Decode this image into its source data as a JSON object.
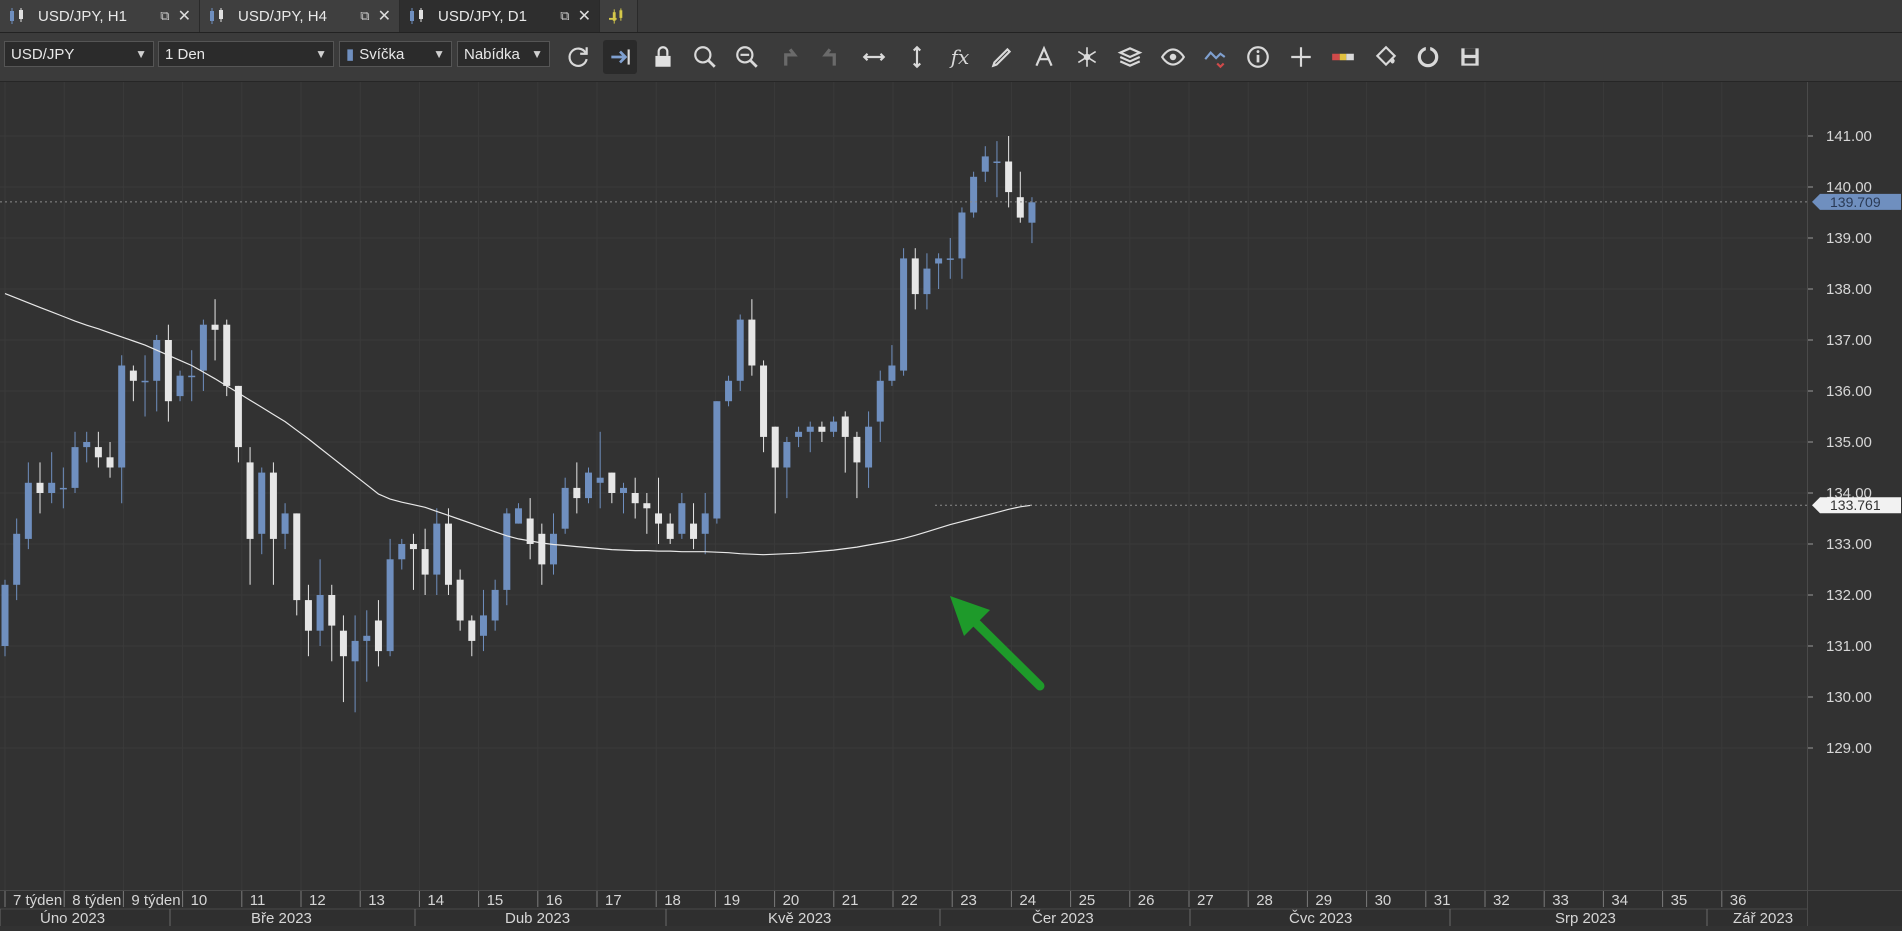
{
  "tabs": [
    {
      "label": "USD/JPY, H1"
    },
    {
      "label": "USD/JPY, H4"
    },
    {
      "label": "USD/JPY, D1"
    }
  ],
  "toolbar": {
    "instrument": "USD/JPY",
    "period": "1 Den",
    "chart_style": "Svíčka",
    "price_side": "Nabídka",
    "icons": [
      "refresh-icon",
      "shift-chart-icon",
      "lock-icon",
      "zoom-in-icon",
      "zoom-out-icon",
      "undo-icon",
      "redo-icon",
      "fit-horizontal-icon",
      "fit-vertical-icon",
      "indicators-fx-icon",
      "pencil-icon",
      "text-tool-icon",
      "pattern-icon",
      "layers-icon",
      "eye-icon",
      "signals-icon",
      "info-icon",
      "crosshair-icon",
      "color-bar-icon",
      "fill-bucket-icon",
      "reset-icon",
      "save-icon"
    ]
  },
  "colors": {
    "bull": "#6f8fbf",
    "bear": "#e6e6e6",
    "ma": "#e8e8e8",
    "arrow": "#1e9a2a",
    "price_tag": "#6f8fbf"
  },
  "chart_data": {
    "type": "candlestick",
    "yticks": [
      "141.00",
      "140.00",
      "139.00",
      "138.00",
      "137.00",
      "136.00",
      "135.00",
      "134.00",
      "133.00",
      "132.00",
      "131.00",
      "130.00",
      "129.00"
    ],
    "ylim": [
      128.6,
      141.9
    ],
    "current_price": "139.709",
    "ma_value": "133.761",
    "candles": [
      [
        131.0,
        132.2,
        130.8,
        132.3
      ],
      [
        132.2,
        133.2,
        131.9,
        133.5
      ],
      [
        133.1,
        134.2,
        132.9,
        134.6
      ],
      [
        134.2,
        134.0,
        133.6,
        134.6
      ],
      [
        134.0,
        134.2,
        133.8,
        134.8
      ],
      [
        134.1,
        134.1,
        133.7,
        134.5
      ],
      [
        134.1,
        134.9,
        134.0,
        135.2
      ],
      [
        134.9,
        135.0,
        134.6,
        135.2
      ],
      [
        134.9,
        134.7,
        134.5,
        135.2
      ],
      [
        134.7,
        134.5,
        134.3,
        135.0
      ],
      [
        134.5,
        136.5,
        133.8,
        136.7
      ],
      [
        136.4,
        136.2,
        135.8,
        136.5
      ],
      [
        136.2,
        136.2,
        135.5,
        136.7
      ],
      [
        136.2,
        137.0,
        135.6,
        137.1
      ],
      [
        137.0,
        135.8,
        135.4,
        137.3
      ],
      [
        135.9,
        136.3,
        135.8,
        136.4
      ],
      [
        136.3,
        136.3,
        135.8,
        136.8
      ],
      [
        136.4,
        137.3,
        136.0,
        137.4
      ],
      [
        137.3,
        137.2,
        136.6,
        137.8
      ],
      [
        137.3,
        136.1,
        135.9,
        137.4
      ],
      [
        136.1,
        134.9,
        134.6,
        136.1
      ],
      [
        134.6,
        133.1,
        132.2,
        134.9
      ],
      [
        133.2,
        134.4,
        132.8,
        134.5
      ],
      [
        134.4,
        133.1,
        132.2,
        134.6
      ],
      [
        133.2,
        133.6,
        132.9,
        133.8
      ],
      [
        133.6,
        131.9,
        131.6,
        133.6
      ],
      [
        131.9,
        131.3,
        130.8,
        132.2
      ],
      [
        131.3,
        132.0,
        131.0,
        132.7
      ],
      [
        132.0,
        131.4,
        130.7,
        132.2
      ],
      [
        131.3,
        130.8,
        129.9,
        131.6
      ],
      [
        130.7,
        131.1,
        129.7,
        131.6
      ],
      [
        131.1,
        131.2,
        130.3,
        131.7
      ],
      [
        131.5,
        130.9,
        130.6,
        131.9
      ],
      [
        130.9,
        132.7,
        130.8,
        133.1
      ],
      [
        132.7,
        133.0,
        132.5,
        133.1
      ],
      [
        133.0,
        132.9,
        132.1,
        133.2
      ],
      [
        132.9,
        132.4,
        132.0,
        133.3
      ],
      [
        132.4,
        133.4,
        132.0,
        133.7
      ],
      [
        133.4,
        132.2,
        132.0,
        133.7
      ],
      [
        132.3,
        131.5,
        131.3,
        132.5
      ],
      [
        131.5,
        131.1,
        130.8,
        131.6
      ],
      [
        131.2,
        131.6,
        130.9,
        132.1
      ],
      [
        131.5,
        132.1,
        131.3,
        132.3
      ],
      [
        132.1,
        133.6,
        131.8,
        133.7
      ],
      [
        133.4,
        133.7,
        133.4,
        133.8
      ],
      [
        133.5,
        133.0,
        132.7,
        133.9
      ],
      [
        133.2,
        132.6,
        132.2,
        133.4
      ],
      [
        132.6,
        133.2,
        132.4,
        133.6
      ],
      [
        133.3,
        134.1,
        133.2,
        134.3
      ],
      [
        134.1,
        133.9,
        133.6,
        134.6
      ],
      [
        133.9,
        134.4,
        133.8,
        134.5
      ],
      [
        134.2,
        134.3,
        133.7,
        135.2
      ],
      [
        134.4,
        134.0,
        133.8,
        134.4
      ],
      [
        134.0,
        134.1,
        133.6,
        134.2
      ],
      [
        134.0,
        133.8,
        133.5,
        134.3
      ],
      [
        133.8,
        133.7,
        133.2,
        134.0
      ],
      [
        133.6,
        133.4,
        133.0,
        134.3
      ],
      [
        133.4,
        133.1,
        133.0,
        133.6
      ],
      [
        133.2,
        133.8,
        133.1,
        134.0
      ],
      [
        133.4,
        133.1,
        132.9,
        133.8
      ],
      [
        133.2,
        133.6,
        132.8,
        134.0
      ],
      [
        133.5,
        135.8,
        133.4,
        135.8
      ],
      [
        135.8,
        136.2,
        135.7,
        136.3
      ],
      [
        136.2,
        137.4,
        136.0,
        137.5
      ],
      [
        137.4,
        136.5,
        136.3,
        137.8
      ],
      [
        136.5,
        135.1,
        134.8,
        136.6
      ],
      [
        135.3,
        134.5,
        133.6,
        135.3
      ],
      [
        134.5,
        135.0,
        133.9,
        135.1
      ],
      [
        135.1,
        135.2,
        134.9,
        135.3
      ],
      [
        135.2,
        135.3,
        134.8,
        135.4
      ],
      [
        135.3,
        135.2,
        135.0,
        135.4
      ],
      [
        135.2,
        135.4,
        135.1,
        135.5
      ],
      [
        135.5,
        135.1,
        134.4,
        135.6
      ],
      [
        135.1,
        134.6,
        133.9,
        135.2
      ],
      [
        134.5,
        135.3,
        134.1,
        135.6
      ],
      [
        135.4,
        136.2,
        135.0,
        136.4
      ],
      [
        136.2,
        136.5,
        136.1,
        136.9
      ],
      [
        136.4,
        138.6,
        136.3,
        138.8
      ],
      [
        138.6,
        137.9,
        137.6,
        138.8
      ],
      [
        137.9,
        138.4,
        137.6,
        138.7
      ],
      [
        138.5,
        138.6,
        138.0,
        138.7
      ],
      [
        138.6,
        138.6,
        138.2,
        139.0
      ],
      [
        138.6,
        139.5,
        138.2,
        139.6
      ],
      [
        139.5,
        140.2,
        139.4,
        140.3
      ],
      [
        140.3,
        140.6,
        140.1,
        140.8
      ],
      [
        140.5,
        140.5,
        139.8,
        140.9
      ],
      [
        140.5,
        139.9,
        139.6,
        141.0
      ],
      [
        139.8,
        139.4,
        139.3,
        140.3
      ],
      [
        139.3,
        139.7,
        138.9,
        139.8
      ]
    ],
    "ma": [
      137.91,
      137.82,
      137.73,
      137.64,
      137.55,
      137.46,
      137.37,
      137.29,
      137.22,
      137.14,
      137.06,
      136.98,
      136.9,
      136.8,
      136.7,
      136.6,
      136.5,
      136.37,
      136.24,
      136.1,
      135.96,
      135.82,
      135.68,
      135.54,
      135.4,
      135.23,
      135.06,
      134.88,
      134.7,
      134.52,
      134.34,
      134.16,
      133.98,
      133.88,
      133.82,
      133.77,
      133.72,
      133.64,
      133.56,
      133.48,
      133.4,
      133.32,
      133.24,
      133.16,
      133.1,
      133.06,
      133.02,
      132.99,
      132.97,
      132.95,
      132.93,
      132.91,
      132.89,
      132.88,
      132.87,
      132.87,
      132.86,
      132.86,
      132.85,
      132.85,
      132.85,
      132.84,
      132.83,
      132.81,
      132.8,
      132.79,
      132.8,
      132.81,
      132.82,
      132.84,
      132.86,
      132.88,
      132.91,
      132.94,
      132.98,
      133.02,
      133.06,
      133.11,
      133.17,
      133.24,
      133.31,
      133.38,
      133.44,
      133.5,
      133.56,
      133.62,
      133.68,
      133.73,
      133.76
    ],
    "x_top_labels": [
      "7 týden",
      "8 týden",
      "9 týden",
      "10",
      "11",
      "12",
      "13",
      "14",
      "15",
      "16",
      "17",
      "18",
      "19",
      "20",
      "21",
      "22",
      "23",
      "24",
      "25",
      "26",
      "27",
      "28",
      "29",
      "30",
      "31",
      "32",
      "33",
      "34",
      "35",
      "36"
    ],
    "x_bottom_labels": [
      "Úno 2023",
      "Bře 2023",
      "Dub 2023",
      "Kvě 2023",
      "Čer 2023",
      "Čvc 2023",
      "Srp 2023",
      "Zář 2023"
    ]
  }
}
